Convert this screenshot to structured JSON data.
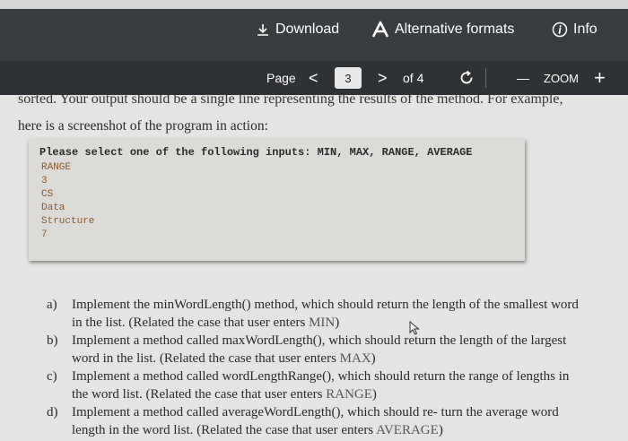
{
  "toolbar": {
    "download_label": "Download",
    "alternative_label": "Alternative formats",
    "info_label": "Info"
  },
  "navbar": {
    "page_label": "Page",
    "current_page": "3",
    "of_label": "of 4",
    "zoom_label": "ZOOM",
    "zoom_out_symbol": "—",
    "zoom_in_symbol": "+",
    "prev_symbol": "<",
    "next_symbol": ">"
  },
  "document": {
    "cut_line": "sorted. Your output should be a single line representing the results of the method. For example,",
    "intro_line": "here is a screenshot of the program in action:",
    "console": {
      "prompt": "Please select one of the following inputs: MIN, MAX, RANGE, AVERAGE",
      "inputs": [
        "RANGE",
        "3",
        "CS",
        "Data",
        "Structure",
        "7"
      ]
    },
    "questions": [
      {
        "letter": "a)",
        "text": "Implement the minWordLength() method, which should return the length of the smallest word in the list. (Related the case that user enters ",
        "code": "MIN",
        "end": ")"
      },
      {
        "letter": "b)",
        "text": "Implement a method called maxWordLength(), which should return the length of the largest word in the list. (Related the case that user enters ",
        "code": "MAX",
        "end": ")"
      },
      {
        "letter": "c)",
        "text": "Implement a method called wordLengthRange(), which should return the range of lengths in the word list. (Related the case that user enters ",
        "code": "RANGE",
        "end": ")"
      },
      {
        "letter": "d)",
        "text": "Implement a method called averageWordLength(), which should re- turn the average word length in the word list. (Related the case that user enters ",
        "code": "AVERAGE",
        "end": ")"
      }
    ]
  },
  "icons": {
    "download": "download-icon",
    "alternative": "accessibility-a-icon",
    "info": "info-icon",
    "rotate": "rotate-icon",
    "cursor": "mouse-pointer-icon"
  },
  "colors": {
    "toolbar_bg": "#3a3d40",
    "navbar_bg": "#2f3235",
    "page_bg": "#e4e4e2",
    "console_input": "#8b5a2b"
  }
}
